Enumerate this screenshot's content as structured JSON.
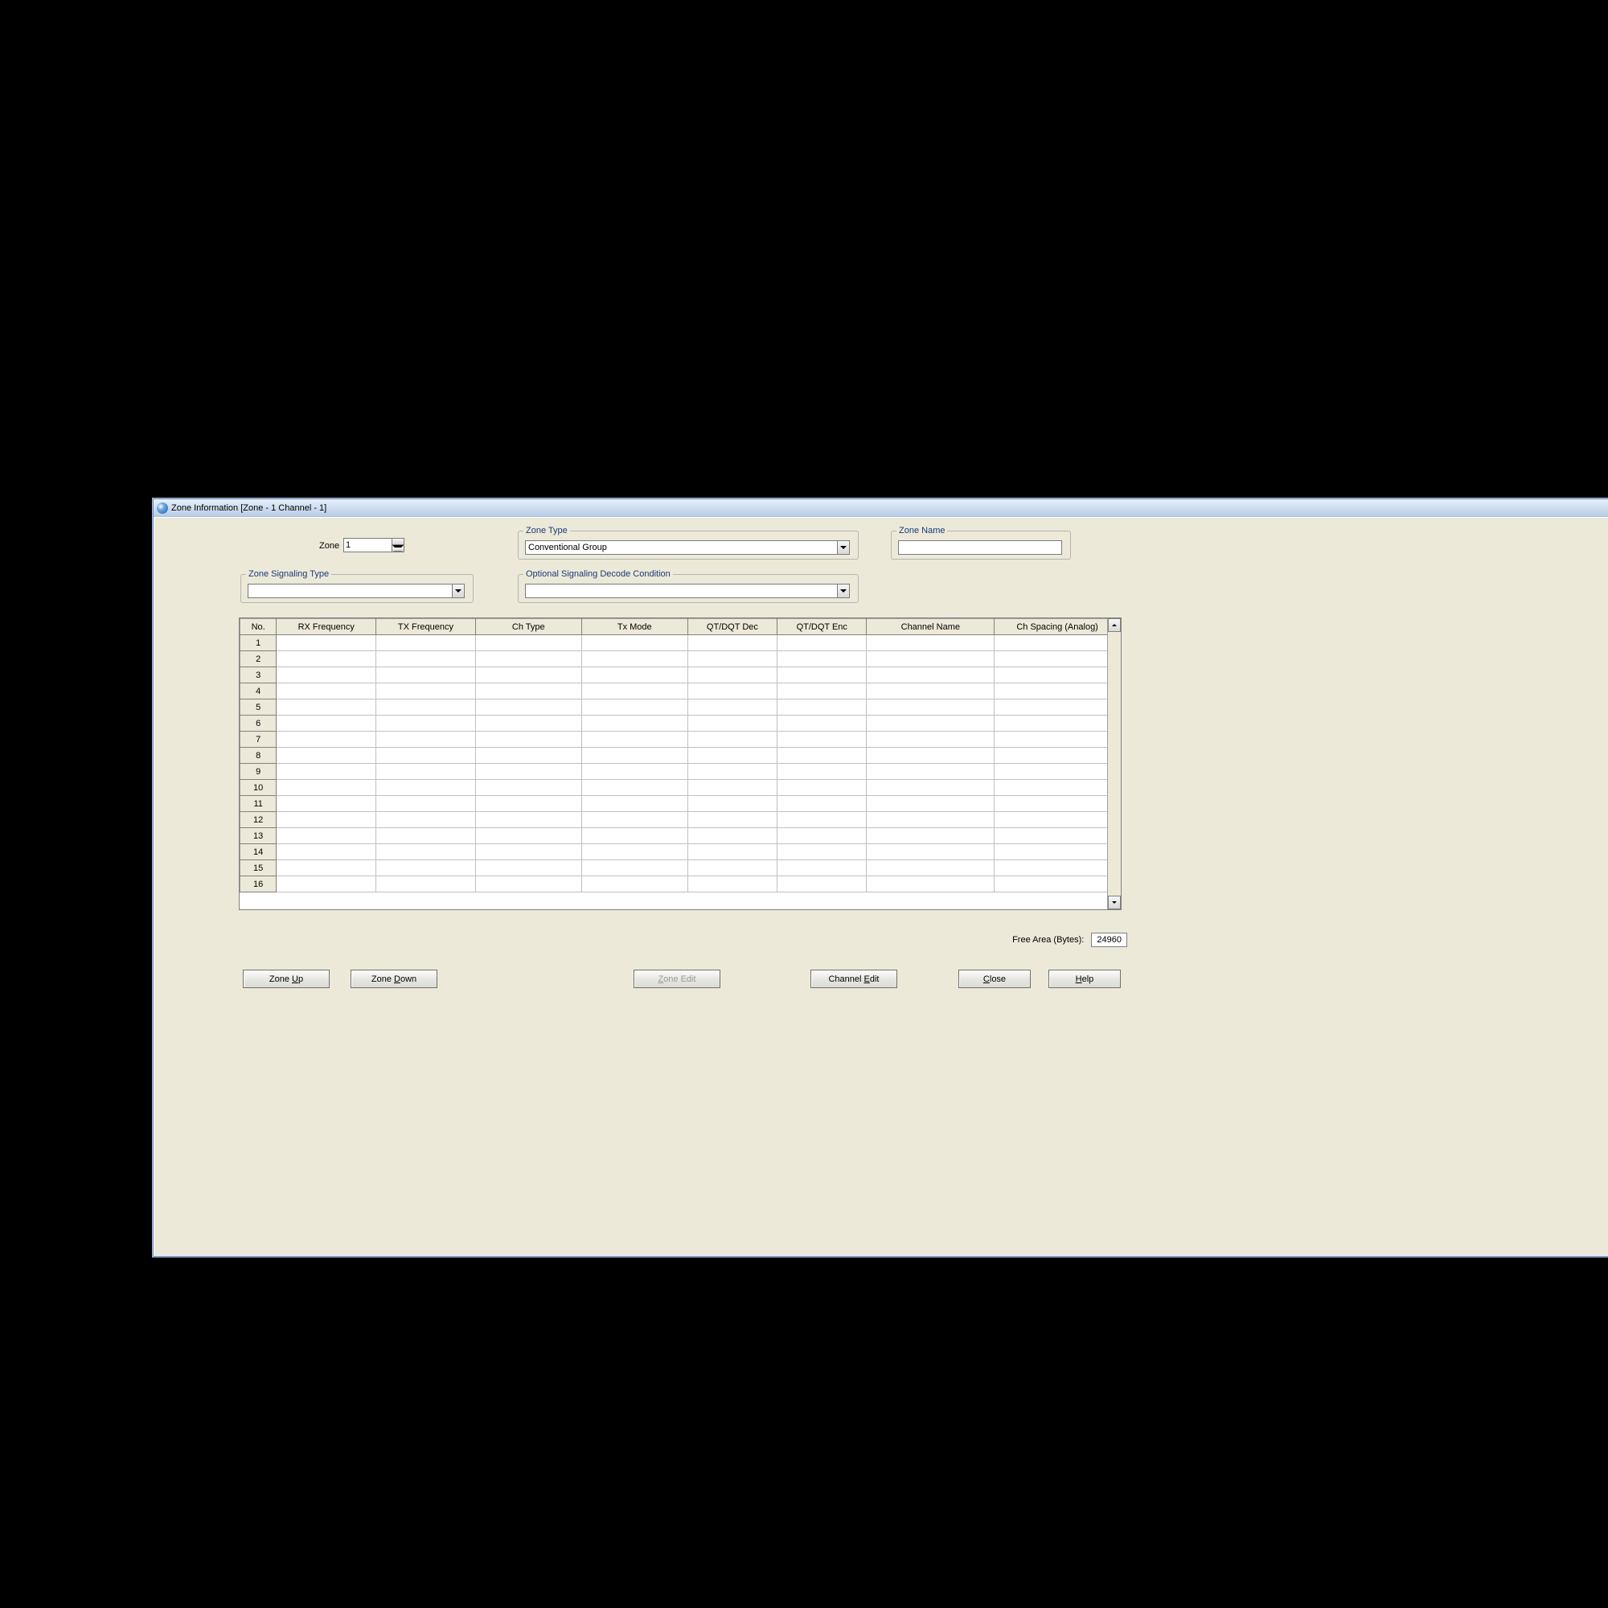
{
  "window": {
    "title": "Zone Information [Zone - 1   Channel  -  1]"
  },
  "zone": {
    "label": "Zone",
    "value": "1"
  },
  "zone_type": {
    "legend": "Zone Type",
    "value": "Conventional Group"
  },
  "zone_name": {
    "legend": "Zone Name",
    "value": ""
  },
  "zone_signaling": {
    "legend": "Zone Signaling Type",
    "value": ""
  },
  "optional_signaling": {
    "legend": "Optional Signaling Decode Condition",
    "value": ""
  },
  "table": {
    "headers": [
      "No.",
      "RX Frequency",
      "TX Frequency",
      "Ch Type",
      "Tx Mode",
      "QT/DQT Dec",
      "QT/DQT Enc",
      "Channel Name",
      "Ch Spacing (Analog)"
    ],
    "row_count": 16
  },
  "free_area": {
    "label": "Free Area (Bytes):",
    "value": "24960"
  },
  "buttons": {
    "zone_up": "Zone Up",
    "zone_down": "Zone Down",
    "zone_edit": "Zone Edit",
    "channel_edit": "Channel Edit",
    "close": "Close",
    "help": "Help"
  }
}
